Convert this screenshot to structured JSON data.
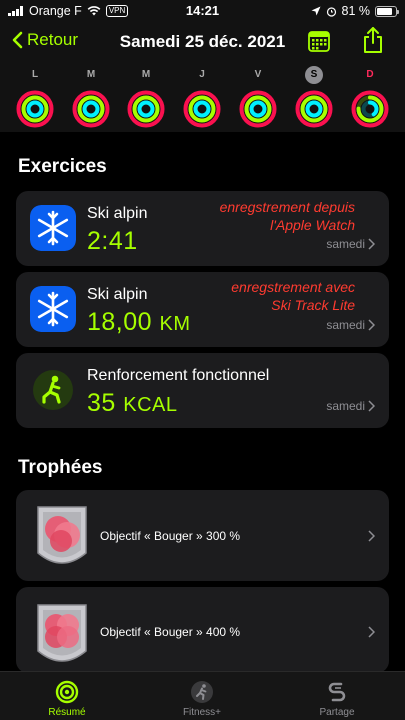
{
  "status_bar": {
    "carrier": "Orange F",
    "vpn": "VPN",
    "time": "14:21",
    "battery": "81 %",
    "battery_level": 0.81
  },
  "nav": {
    "back_label": "Retour",
    "title": "Samedi 25 déc. 2021",
    "accent_color": "#a6ff00"
  },
  "week": {
    "days": [
      {
        "letter": "L",
        "move": 1.0,
        "exercise": 1.0,
        "stand": 1.0
      },
      {
        "letter": "M",
        "move": 1.0,
        "exercise": 1.0,
        "stand": 1.0
      },
      {
        "letter": "M",
        "move": 1.0,
        "exercise": 1.0,
        "stand": 1.0
      },
      {
        "letter": "J",
        "move": 1.0,
        "exercise": 1.0,
        "stand": 1.0
      },
      {
        "letter": "V",
        "move": 1.0,
        "exercise": 1.0,
        "stand": 1.0
      },
      {
        "letter": "S",
        "move": 1.0,
        "exercise": 1.0,
        "stand": 1.0,
        "selected": true
      },
      {
        "letter": "D",
        "move": 1.0,
        "exercise": 0.75,
        "stand": 0.4,
        "today": true
      }
    ],
    "ring_colors": {
      "move": "#fa114f",
      "exercise": "#a6ff00",
      "stand": "#00f0ff"
    }
  },
  "exercises": {
    "title": "Exercices",
    "items": [
      {
        "name": "Ski alpin",
        "value": "2:41",
        "unit": "",
        "date": "samedi",
        "icon": "snowflake-icon",
        "annotation": [
          "enregstrement depuis",
          "l'Apple Watch"
        ]
      },
      {
        "name": "Ski alpin",
        "value": "18,00",
        "unit": "KM",
        "date": "samedi",
        "icon": "snowflake-icon",
        "annotation": [
          "enregstrement avec",
          "Ski Track Lite"
        ]
      },
      {
        "name": "Renforcement fonctionnel",
        "value": "35",
        "unit": "KCAL",
        "date": "samedi",
        "icon": "strength-training-icon"
      }
    ]
  },
  "trophies": {
    "title": "Trophées",
    "items": [
      {
        "label": "Objectif « Bouger » 300 %",
        "badge": "move-goal-300-badge"
      },
      {
        "label": "Objectif « Bouger » 400 %",
        "badge": "move-goal-400-badge"
      }
    ]
  },
  "tab_bar": {
    "tabs": [
      {
        "label": "Résumé",
        "icon": "activity-rings-icon",
        "active": true
      },
      {
        "label": "Fitness+",
        "icon": "runner-icon"
      },
      {
        "label": "Partage",
        "icon": "sharing-icon"
      }
    ]
  }
}
